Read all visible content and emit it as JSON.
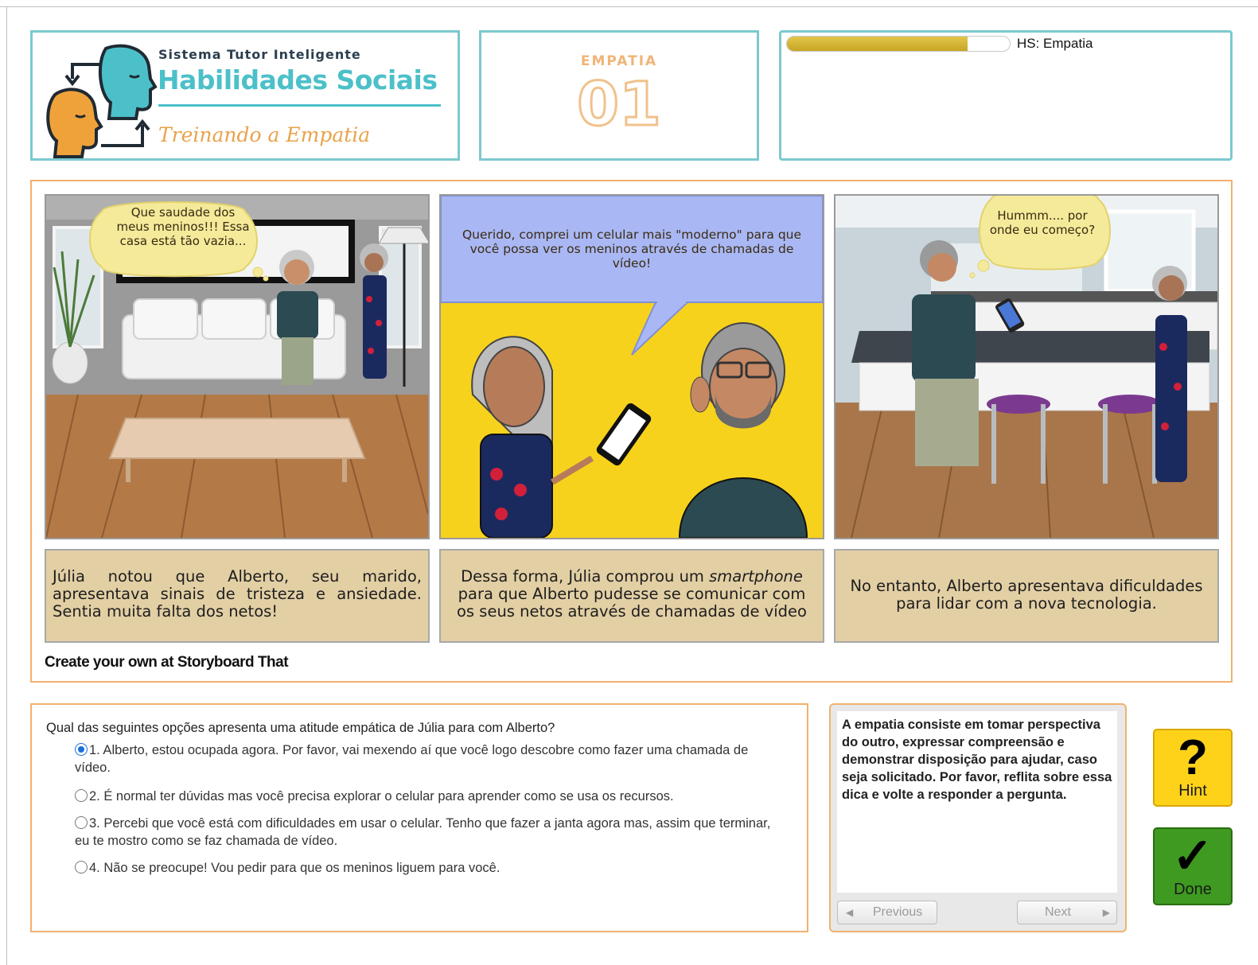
{
  "header": {
    "logo": {
      "subtitle": "Sistema Tutor Inteligente",
      "title": "Habilidades Sociais",
      "tagline": "Treinando a Empatia"
    },
    "module": {
      "label": "EMPATIA",
      "number": "01"
    },
    "progress": {
      "label": "HS: Empatia",
      "fraction": 0.81
    }
  },
  "storyboard": {
    "panels": [
      {
        "bubble": "Que saudade dos meus meninos!!! Essa casa está tão vazia...",
        "caption": "Júlia notou que Alberto, seu marido, apresentava sinais de tristeza e ansiedade. Sentia muita falta dos netos!"
      },
      {
        "bubble": "Querido, comprei um celular mais \"moderno\" para que você possa ver os meninos através de chamadas de vídeo!",
        "caption_before": "Dessa forma, Júlia comprou um ",
        "caption_em": "smartphone",
        "caption_after": " para que Alberto pudesse se comunicar com os seus netos através de chamadas de vídeo"
      },
      {
        "bubble": "Hummm.... por onde eu começo?",
        "caption": "No entanto, Alberto apresentava dificuldades para lidar com a nova tecnologia."
      }
    ],
    "credit": "Create your own at Storyboard That"
  },
  "question": {
    "text": "Qual das seguintes opções apresenta uma atitude empática de Júlia para com Alberto?",
    "selected": 1,
    "options": [
      "1. Alberto, estou ocupada agora. Por favor, vai mexendo aí que você logo descobre como fazer uma chamada de vídeo.",
      "2. É normal ter dúvidas mas você precisa explorar o celular para aprender como se usa os recursos.",
      "3. Percebi que você está com dificuldades em usar o celular. Tenho que fazer a janta agora mas, assim que terminar, eu te mostro como se faz chamada de vídeo.",
      "4. Não se preocupe! Vou pedir para que os meninos liguem para você."
    ]
  },
  "hint": {
    "text": "A empatia consiste em tomar perspectiva do outro, expressar compreensão e demonstrar disposição para ajudar, caso seja solicitado. Por favor, reflita sobre essa dica e volte a responder a pergunta.",
    "previous_label": "Previous",
    "next_label": "Next"
  },
  "actions": {
    "hint_label": "Hint",
    "hint_glyph": "?",
    "done_label": "Done",
    "done_glyph": "✓"
  },
  "colors": {
    "teal": "#4cc0c9",
    "orange_border": "#f2b070",
    "caption_bg": "#e2cfa4",
    "hint_yellow": "#ffd21a",
    "done_green": "#3e9a20",
    "progress_gold": "#d4b232"
  }
}
